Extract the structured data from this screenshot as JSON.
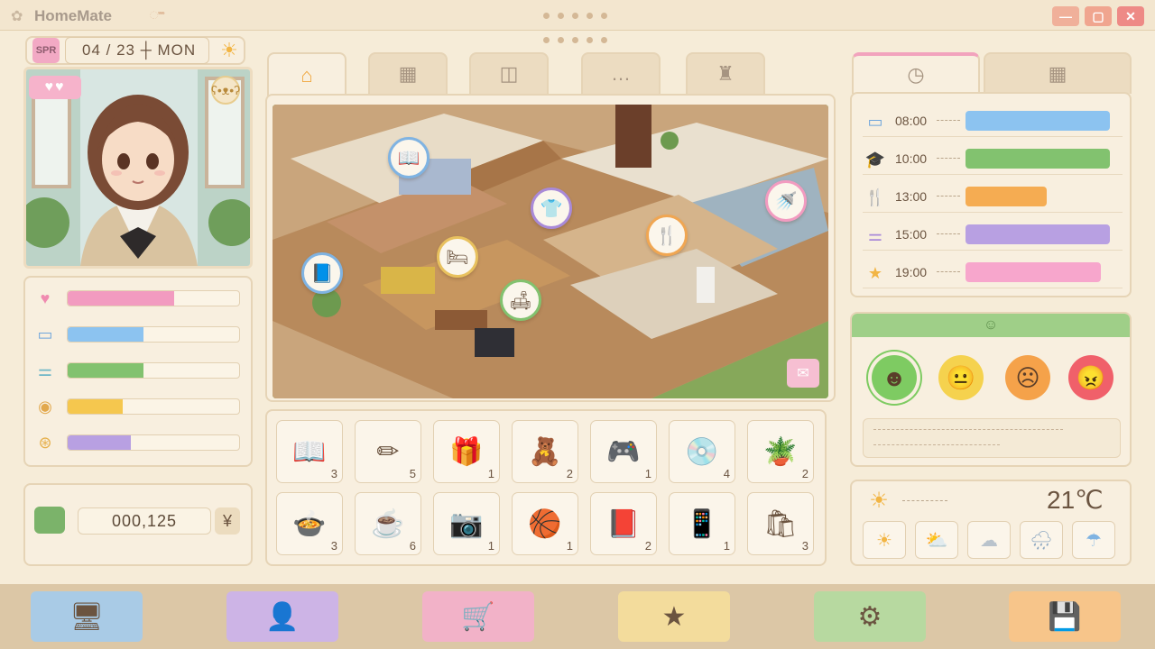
{
  "app": {
    "title": "HomeMate",
    "title_decoration": "ಿಿಿ"
  },
  "window_controls": {
    "minimize": "—",
    "maximize": "▢",
    "close": "✕"
  },
  "date": {
    "season": "SPR",
    "display": "04 / 23 ┼ MON"
  },
  "character": {
    "affection": "♥♥"
  },
  "stats": [
    {
      "name": "affection",
      "icon": "heart-icon",
      "glyph": "♥",
      "color": "#f29bc0",
      "icon_color": "#f08bb0",
      "level": 0.62
    },
    {
      "name": "study",
      "icon": "book-icon",
      "glyph": "▭",
      "color": "#8cc3f0",
      "icon_color": "#6fa6dc",
      "level": 0.44
    },
    {
      "name": "fitness",
      "icon": "dumbbell-icon",
      "glyph": "⚌",
      "color": "#82c26f",
      "icon_color": "#6fb7c7",
      "level": 0.44
    },
    {
      "name": "art",
      "icon": "palette-icon",
      "glyph": "◉",
      "color": "#f5c74e",
      "icon_color": "#e2a84c",
      "level": 0.32
    },
    {
      "name": "money",
      "icon": "coin-icon",
      "glyph": "⊛",
      "color": "#b8a0e2",
      "icon_color": "#e6b04c",
      "level": 0.37
    }
  ],
  "wallet": {
    "amount": "000,125",
    "currency": "¥"
  },
  "tabs": [
    {
      "name": "home",
      "icon": "home-icon",
      "glyph": "⌂",
      "active": true
    },
    {
      "name": "calendar",
      "icon": "grid-icon",
      "glyph": "▦",
      "active": false
    },
    {
      "name": "shop",
      "icon": "bag-icon",
      "glyph": "◫",
      "active": false
    },
    {
      "name": "chat",
      "icon": "chat-icon",
      "glyph": "…",
      "active": false
    },
    {
      "name": "trophy",
      "icon": "trophy-icon",
      "glyph": "♜",
      "active": false
    }
  ],
  "room_markers": [
    {
      "name": "library",
      "icon": "book-icon",
      "glyph": "📖",
      "color": "#7fb3e2"
    },
    {
      "name": "wardrobe",
      "icon": "shirt-icon",
      "glyph": "👕",
      "color": "#a98ad8"
    },
    {
      "name": "kitchen",
      "icon": "fork-knife-icon",
      "glyph": "🍴",
      "color": "#f0a652"
    },
    {
      "name": "bathroom",
      "icon": "shower-icon",
      "glyph": "🚿",
      "color": "#f29bc0"
    },
    {
      "name": "bedroom",
      "icon": "bed-icon",
      "glyph": "🛏",
      "color": "#e8c15e"
    },
    {
      "name": "reading",
      "icon": "book-open-icon",
      "glyph": "📘",
      "color": "#7fb3e2"
    },
    {
      "name": "living",
      "icon": "sofa-icon",
      "glyph": "🛋",
      "color": "#82c26f"
    }
  ],
  "inventory": [
    {
      "icon": "book-icon",
      "glyph": "📖",
      "count": "3"
    },
    {
      "icon": "pencil-icon",
      "glyph": "✏",
      "count": "5"
    },
    {
      "icon": "gift-icon",
      "glyph": "🎁",
      "count": "1"
    },
    {
      "icon": "teddy-bear-icon",
      "glyph": "🧸",
      "count": "2"
    },
    {
      "icon": "game-console-icon",
      "glyph": "🎮",
      "count": "1"
    },
    {
      "icon": "cd-icon",
      "glyph": "💿",
      "count": "4"
    },
    {
      "icon": "plant-icon",
      "glyph": "🪴",
      "count": "2"
    },
    {
      "icon": "bowl-icon",
      "glyph": "🍲",
      "count": "3"
    },
    {
      "icon": "coffee-cup-icon",
      "glyph": "☕",
      "count": "6"
    },
    {
      "icon": "camera-icon",
      "glyph": "📷",
      "count": "1"
    },
    {
      "icon": "basketball-icon",
      "glyph": "🏀",
      "count": "1"
    },
    {
      "icon": "notebook-icon",
      "glyph": "📕",
      "count": "2"
    },
    {
      "icon": "phone-icon",
      "glyph": "📱",
      "count": "1"
    },
    {
      "icon": "shopping-bag-icon",
      "glyph": "🛍",
      "count": "3"
    }
  ],
  "schedule": [
    {
      "time": "08:00",
      "icon": "book-icon",
      "glyph": "▭",
      "icon_color": "#6fa6dc",
      "color": "#8cc3f0",
      "fill": 1.0
    },
    {
      "time": "10:00",
      "icon": "graduation-cap-icon",
      "glyph": "🎓",
      "icon_color": "#d89a3c",
      "color": "#82c26f",
      "fill": 1.0
    },
    {
      "time": "13:00",
      "icon": "fork-knife-icon",
      "glyph": "🍴",
      "icon_color": "#f0a652",
      "color": "#f5ac52",
      "fill": 0.56
    },
    {
      "time": "15:00",
      "icon": "dumbbell-icon",
      "glyph": "⚌",
      "icon_color": "#a98ad8",
      "color": "#b8a0e2",
      "fill": 1.0
    },
    {
      "time": "19:00",
      "icon": "star-icon",
      "glyph": "★",
      "icon_color": "#f2b544",
      "color": "#f7a6cc",
      "fill": 0.94
    }
  ],
  "mood": {
    "header_glyph": "☺",
    "faces": [
      {
        "name": "happy",
        "icon": "happy-face-icon",
        "glyph": "☻",
        "color": "#7ecb62",
        "selected": true
      },
      {
        "name": "neutral",
        "icon": "neutral-face-icon",
        "glyph": "😐",
        "color": "#f5d24e",
        "selected": false
      },
      {
        "name": "sad",
        "icon": "sad-face-icon",
        "glyph": "☹",
        "color": "#f5a24a",
        "selected": false
      },
      {
        "name": "angry",
        "icon": "angry-face-icon",
        "glyph": "😠",
        "color": "#f0606a",
        "selected": false
      }
    ]
  },
  "weather": {
    "temperature": "21℃",
    "forecast": [
      {
        "icon": "sun-icon",
        "glyph": "☀",
        "color": "#f2b544"
      },
      {
        "icon": "partly-cloudy-icon",
        "glyph": "⛅",
        "color": "#f2b544"
      },
      {
        "icon": "cloud-icon",
        "glyph": "☁",
        "color": "#b9c3cc"
      },
      {
        "icon": "rain-icon",
        "glyph": "🌧",
        "color": "#8fa9c2"
      },
      {
        "icon": "umbrella-icon",
        "glyph": "☂",
        "color": "#7fb3e2"
      }
    ]
  },
  "bottom_buttons": [
    {
      "name": "computer",
      "icon": "monitor-icon",
      "glyph": "🖥",
      "color": "#a9cbe6"
    },
    {
      "name": "profile",
      "icon": "user-icon",
      "glyph": "👤",
      "color": "#cdb4e6"
    },
    {
      "name": "shop",
      "icon": "cart-icon",
      "glyph": "🛒",
      "color": "#f2b2c8"
    },
    {
      "name": "favorites",
      "icon": "star-icon",
      "glyph": "★",
      "color": "#f3dc9c"
    },
    {
      "name": "settings",
      "icon": "gear-icon",
      "glyph": "⚙",
      "color": "#b7d9a0"
    },
    {
      "name": "save",
      "icon": "save-icon",
      "glyph": "💾",
      "color": "#f7c58a"
    }
  ]
}
